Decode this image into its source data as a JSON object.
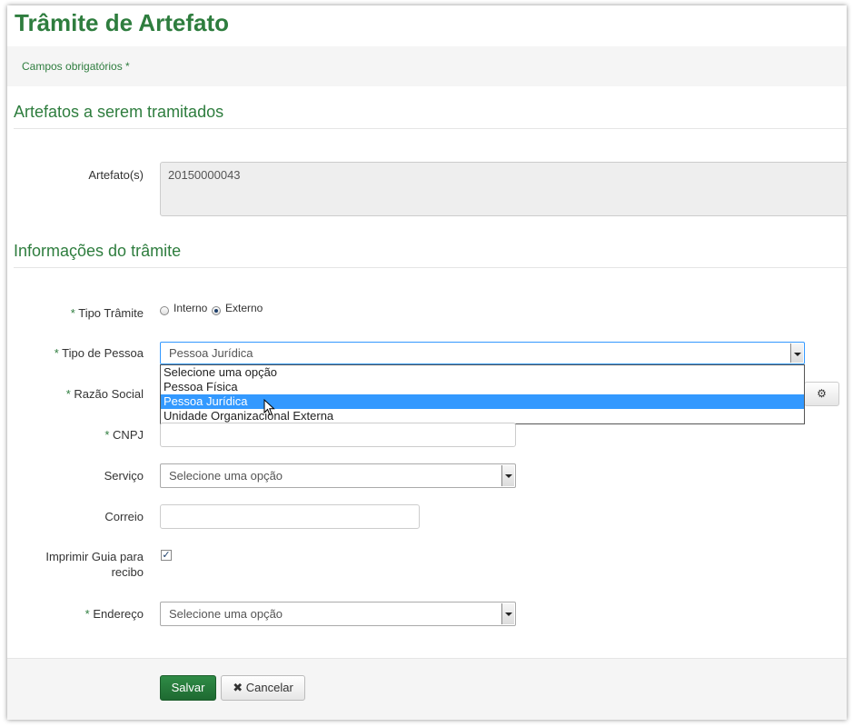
{
  "page": {
    "title": "Trâmite de Artefato",
    "required_note": "Campos obrigatórios *"
  },
  "sections": {
    "artefatos": "Artefatos a serem tramitados",
    "informacoes": "Informações do trâmite"
  },
  "form": {
    "required_marker": "*",
    "artefatos_label": "Artefato(s)",
    "artefatos_value": "20150000043",
    "tipo_tramite_label": "Tipo Trâmite",
    "tipo_tramite_options": [
      "Interno",
      "Externo"
    ],
    "tipo_tramite_selected": "Externo",
    "tipo_pessoa_label": "Tipo de Pessoa",
    "tipo_pessoa_value": "Pessoa Jurídica",
    "tipo_pessoa_options": [
      "Selecione uma opção",
      "Pessoa Física",
      "Pessoa Jurídica",
      "Unidade Organizacional Externa"
    ],
    "tipo_pessoa_highlighted": "Pessoa Jurídica",
    "razao_social_label": "Razão Social",
    "cnpj_label": "CNPJ",
    "servico_label": "Serviço",
    "servico_value": "Selecione uma opção",
    "correio_label": "Correio",
    "imprimir_label_1": "Imprimir Guia para",
    "imprimir_label_2": "recibo",
    "imprimir_checked": true,
    "endereco_label": "Endereço",
    "endereco_value": "Selecione uma opção"
  },
  "buttons": {
    "save": "Salvar",
    "cancel": "Cancelar",
    "cancel_icon": "✖",
    "gear_icon": "gear-icon"
  },
  "colors": {
    "brand_green": "#2e7d3e",
    "highlight_blue": "#3399ff"
  }
}
